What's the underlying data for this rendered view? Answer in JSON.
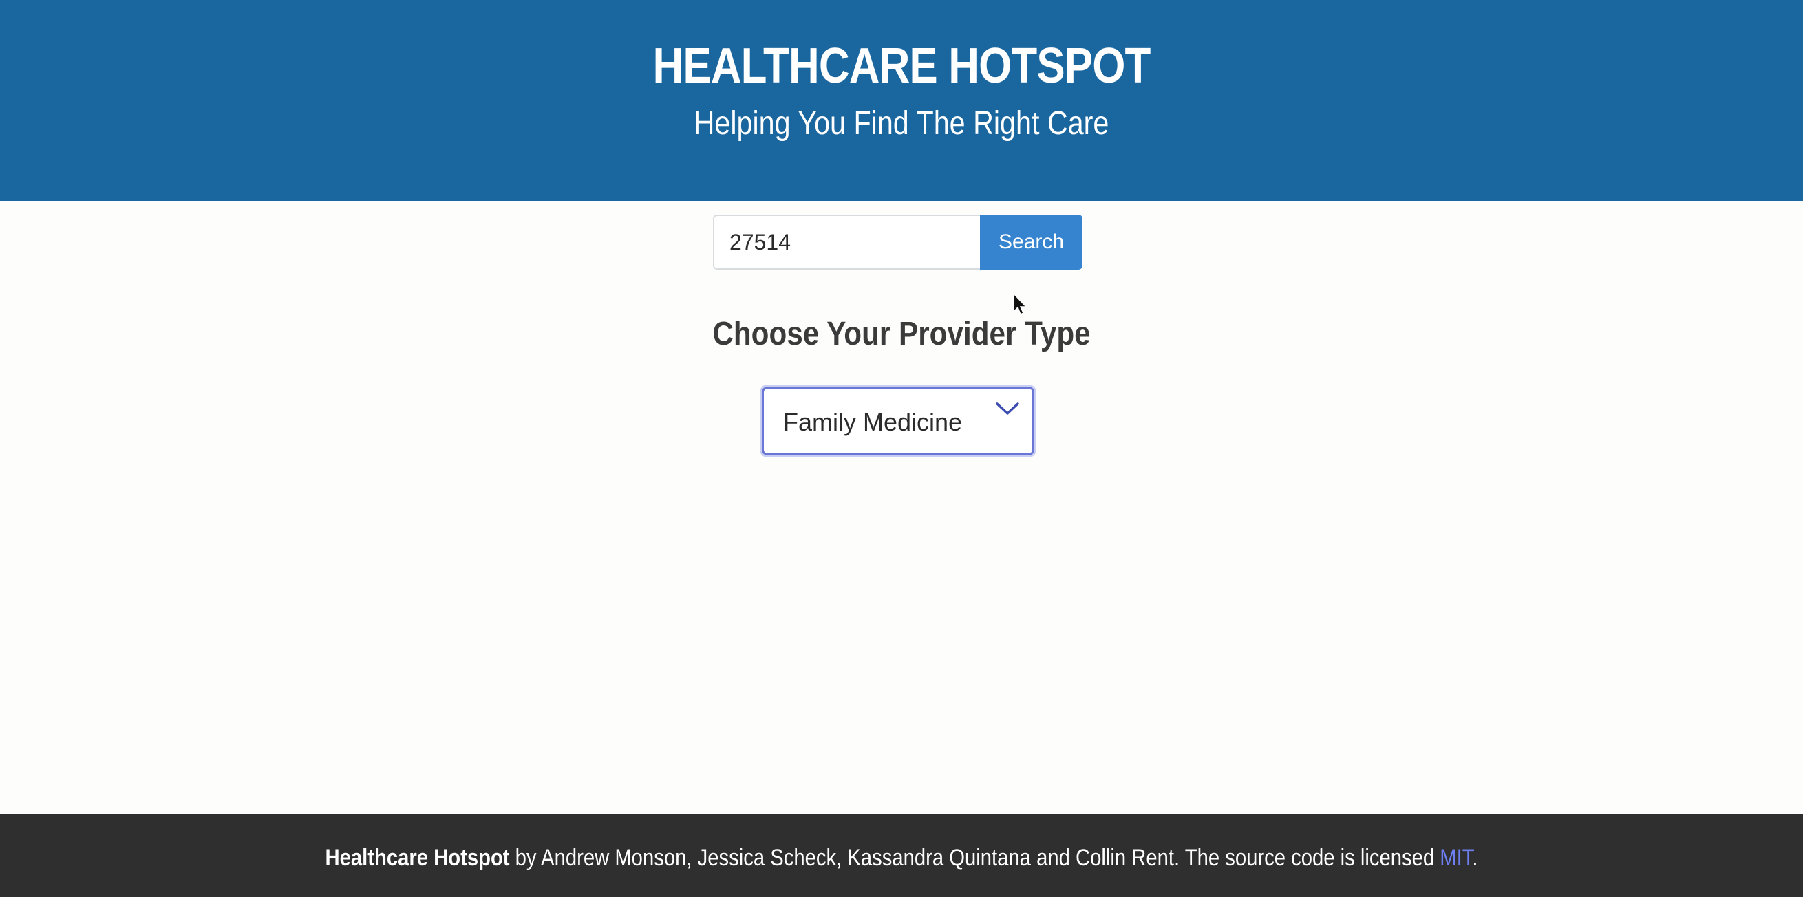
{
  "header": {
    "title": "HEALTHCARE HOTSPOT",
    "subtitle": "Helping You Find The Right Care"
  },
  "search": {
    "value": "27514",
    "button_label": "Search"
  },
  "provider": {
    "heading": "Choose Your Provider Type",
    "selected": "Family Medicine"
  },
  "footer": {
    "brand": "Healthcare Hotspot",
    "text_before_link": " by Andrew Monson, Jessica Scheck, Kassandra Quintana and Collin Rent. The source code is licensed ",
    "link_label": "MIT",
    "text_after_link": "."
  },
  "colors": {
    "header_bg": "#1a67a0",
    "button_bg": "#3683cf",
    "footer_bg": "#2f2f2f",
    "link": "#6d7ff0"
  }
}
